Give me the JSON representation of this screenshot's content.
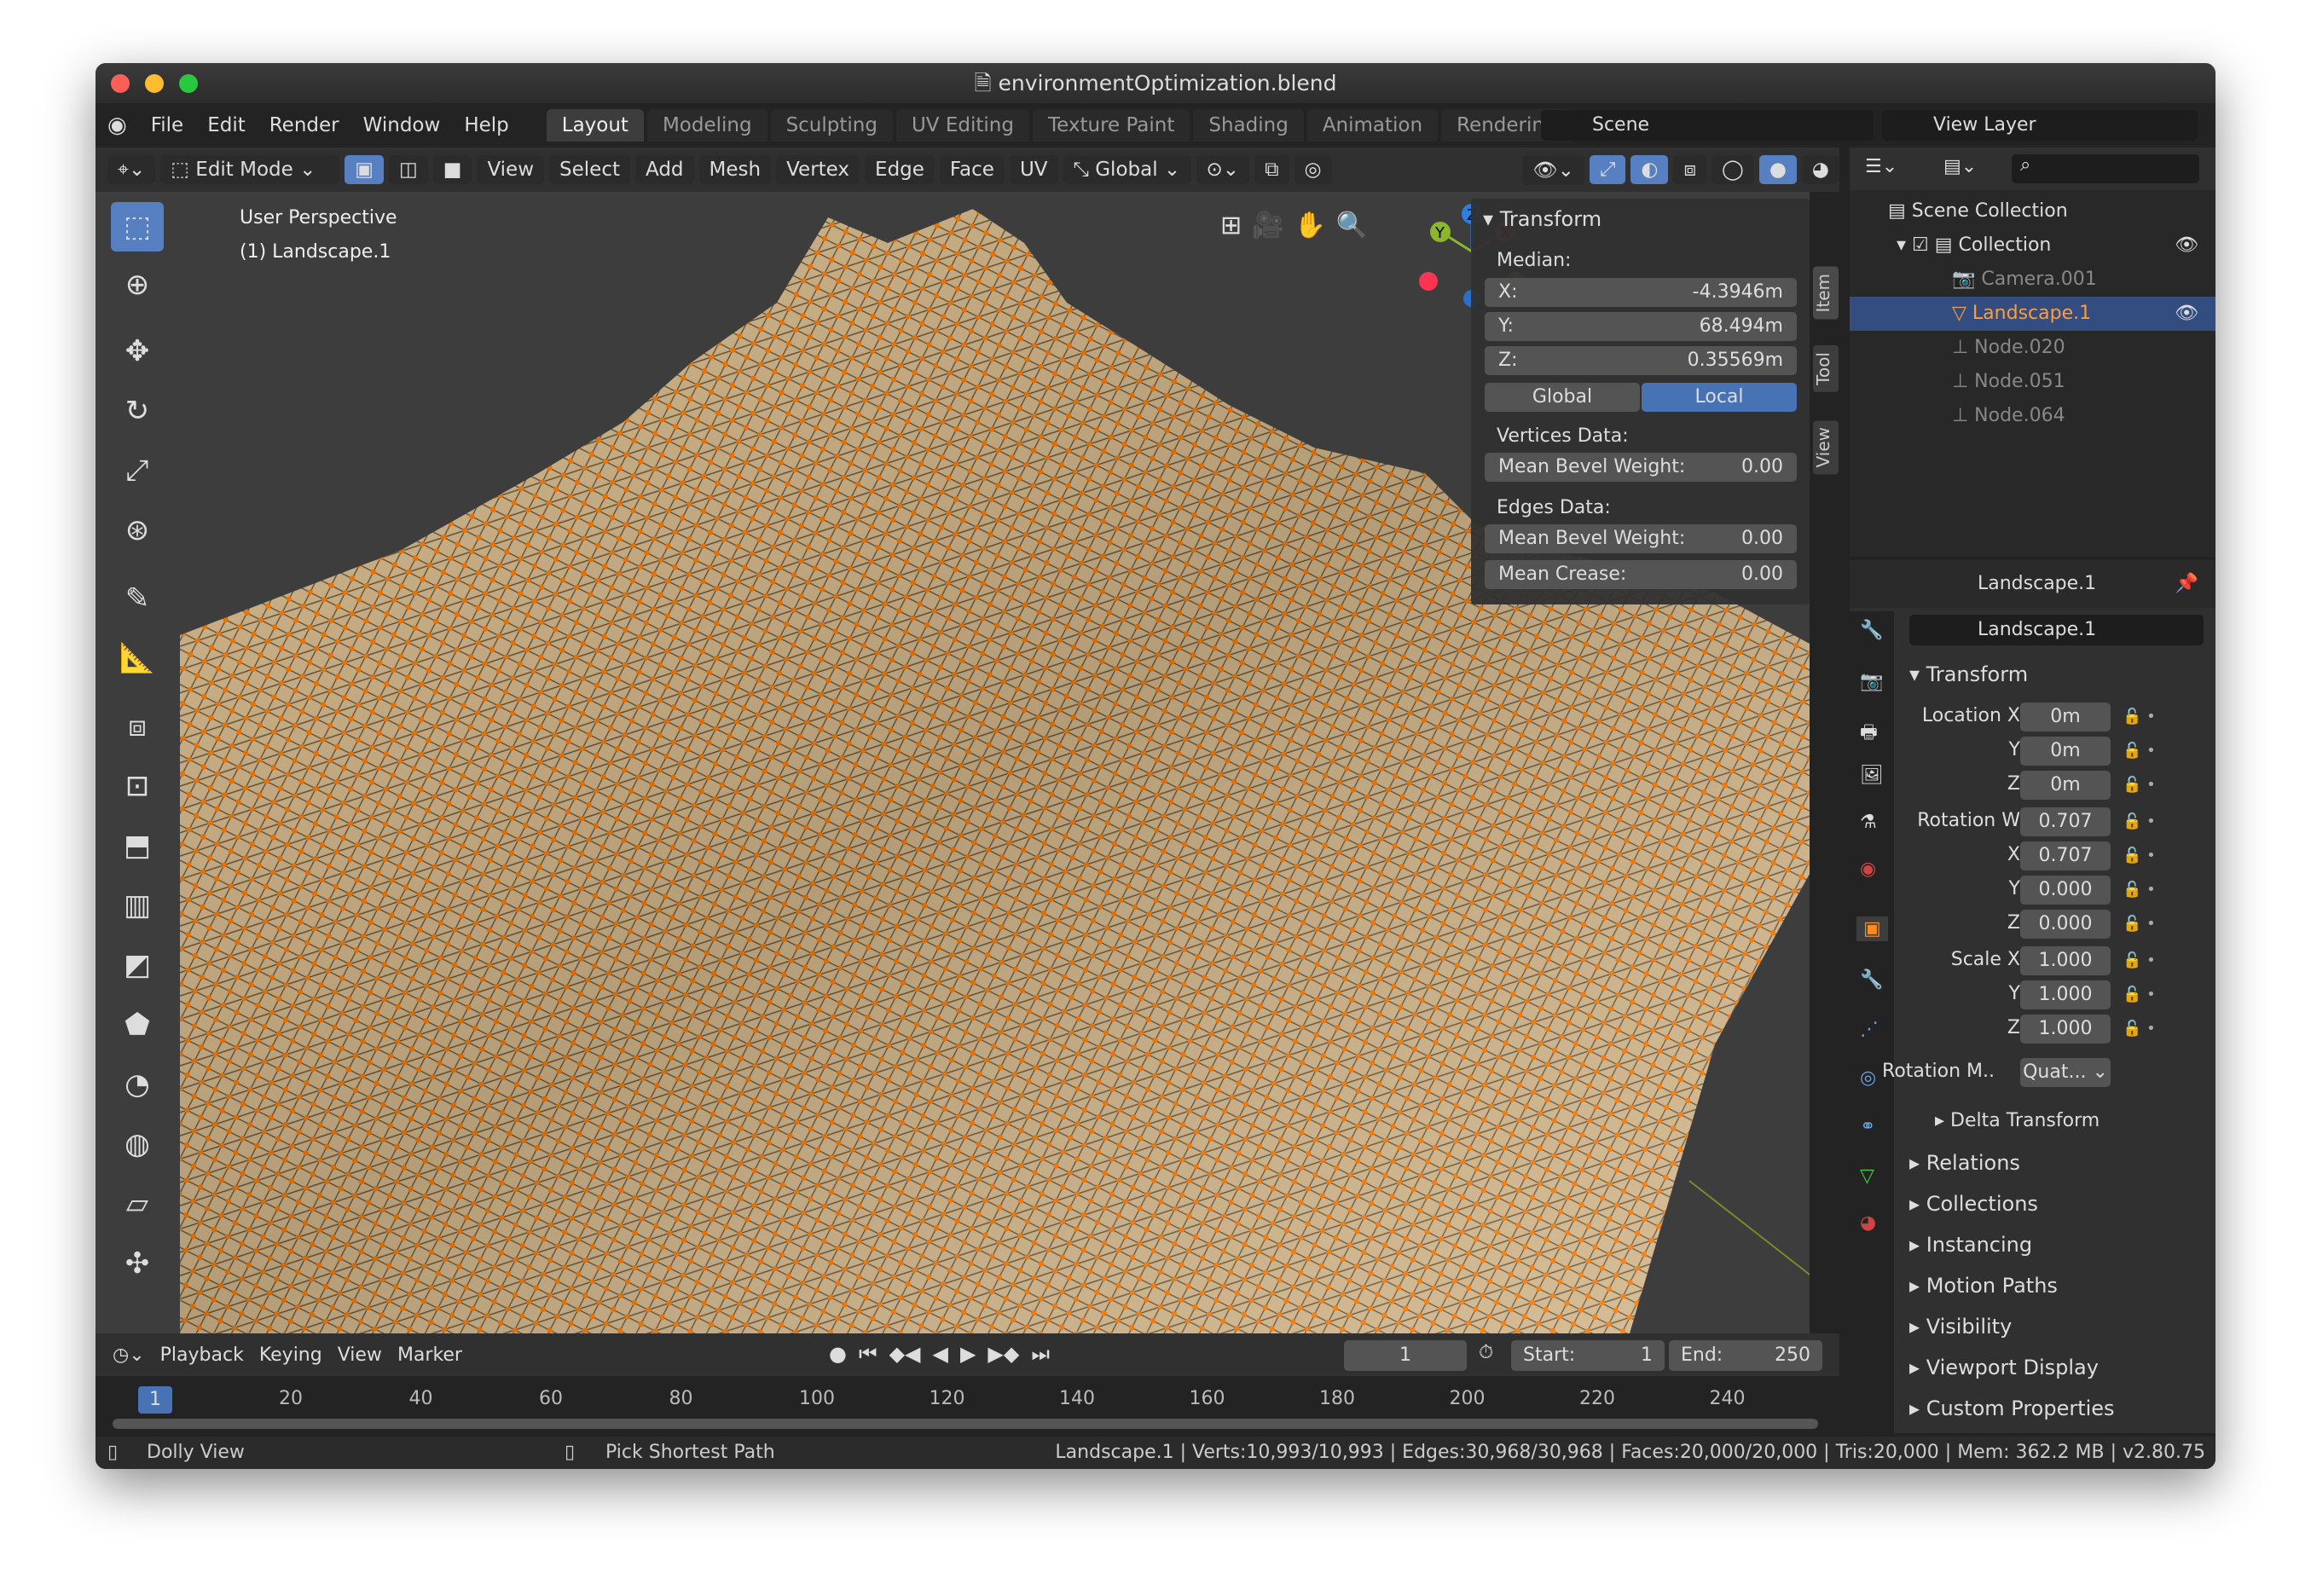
{
  "window": {
    "title": "environmentOptimization.blend"
  },
  "menu": {
    "items": [
      "File",
      "Edit",
      "Render",
      "Window",
      "Help"
    ]
  },
  "workspaces": {
    "tabs": [
      "Layout",
      "Modeling",
      "Sculpting",
      "UV Editing",
      "Texture Paint",
      "Shading",
      "Animation",
      "Rendering"
    ],
    "active": "Layout"
  },
  "scene": {
    "label": "Scene"
  },
  "view_layer": {
    "label": "View Layer"
  },
  "header": {
    "mode": "Edit Mode",
    "items": [
      "View",
      "Select",
      "Add",
      "Mesh",
      "Vertex",
      "Edge",
      "Face",
      "UV"
    ],
    "orientation": "Global"
  },
  "viewport": {
    "perspective": "User Perspective",
    "object": "(1) Landscape.1",
    "mesh_color": "#d4b88c",
    "vertex_color": "#ff7a00"
  },
  "npanel": {
    "title": "Transform",
    "median": "Median:",
    "x_label": "X:",
    "x": "-4.3946m",
    "y_label": "Y:",
    "y": "68.494m",
    "z_label": "Z:",
    "z": "0.35569m",
    "global": "Global",
    "local": "Local",
    "vertices_data": "Vertices Data:",
    "mean_bevel_weight": "Mean Bevel Weight:",
    "v_bevel": "0.00",
    "edges_data": "Edges Data:",
    "e_bevel": "0.00",
    "mean_crease": "Mean Crease:",
    "crease": "0.00",
    "tabs": [
      "Item",
      "Tool",
      "View"
    ]
  },
  "outliner": {
    "root": "Scene Collection",
    "collection": "Collection",
    "items": [
      "Camera.001",
      "Landscape.1",
      "Node.020",
      "Node.051",
      "Node.064"
    ],
    "active": "Landscape.1"
  },
  "properties": {
    "object_name": "Landscape.1",
    "data_name": "Landscape.1",
    "transform": "Transform",
    "location_x_label": "Location X",
    "location": [
      "0m",
      "0m",
      "0m"
    ],
    "rotation_w_label": "Rotation W",
    "rotation": [
      "0.707",
      "0.707",
      "0.000",
      "0.000"
    ],
    "scale_x_label": "Scale X",
    "scale": [
      "1.000",
      "1.000",
      "1.000"
    ],
    "y_label": "Y",
    "z_label": "Z",
    "x_label": "X",
    "rotation_mode_label": "Rotation M..",
    "rotation_mode": "Quat...",
    "delta": "Delta Transform",
    "sections": [
      "Relations",
      "Collections",
      "Instancing",
      "Motion Paths",
      "Visibility",
      "Viewport Display",
      "Custom Properties"
    ]
  },
  "timeline": {
    "menus": [
      "Playback",
      "Keying",
      "View",
      "Marker"
    ],
    "current_frame": "1",
    "start_label": "Start:",
    "start": "1",
    "end_label": "End:",
    "end": "250",
    "ticks": [
      "20",
      "40",
      "60",
      "80",
      "100",
      "120",
      "140",
      "160",
      "180",
      "200",
      "220",
      "240"
    ]
  },
  "status": {
    "left": "Dolly View",
    "middle": "Pick Shortest Path",
    "stats": "Landscape.1 | Verts:10,993/10,993 | Edges:30,968/30,968 | Faces:20,000/20,000 | Tris:20,000 | Mem: 362.2 MB | v2.80.75"
  }
}
